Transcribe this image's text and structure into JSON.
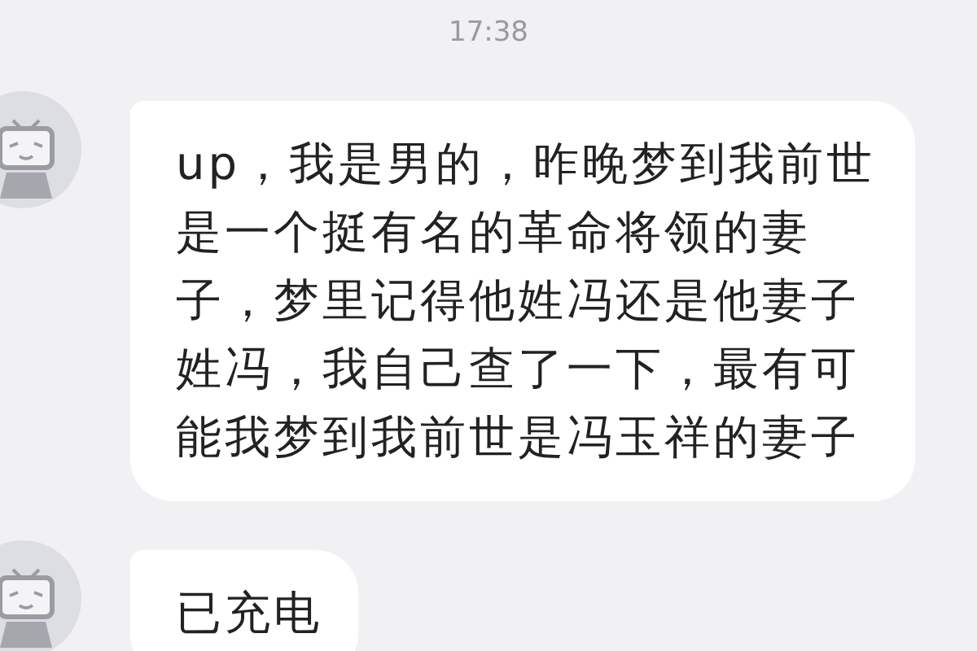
{
  "timestamp": "17:38",
  "messages": [
    {
      "kind": "received",
      "text": "up，我是男的，昨晚梦到我前世是一个挺有名的革命将领的妻子，梦里记得他姓冯还是他妻子姓冯，我自己查了一下，最有可能我梦到我前世是冯玉祥的妻子"
    },
    {
      "kind": "received",
      "text": "已充电"
    }
  ]
}
